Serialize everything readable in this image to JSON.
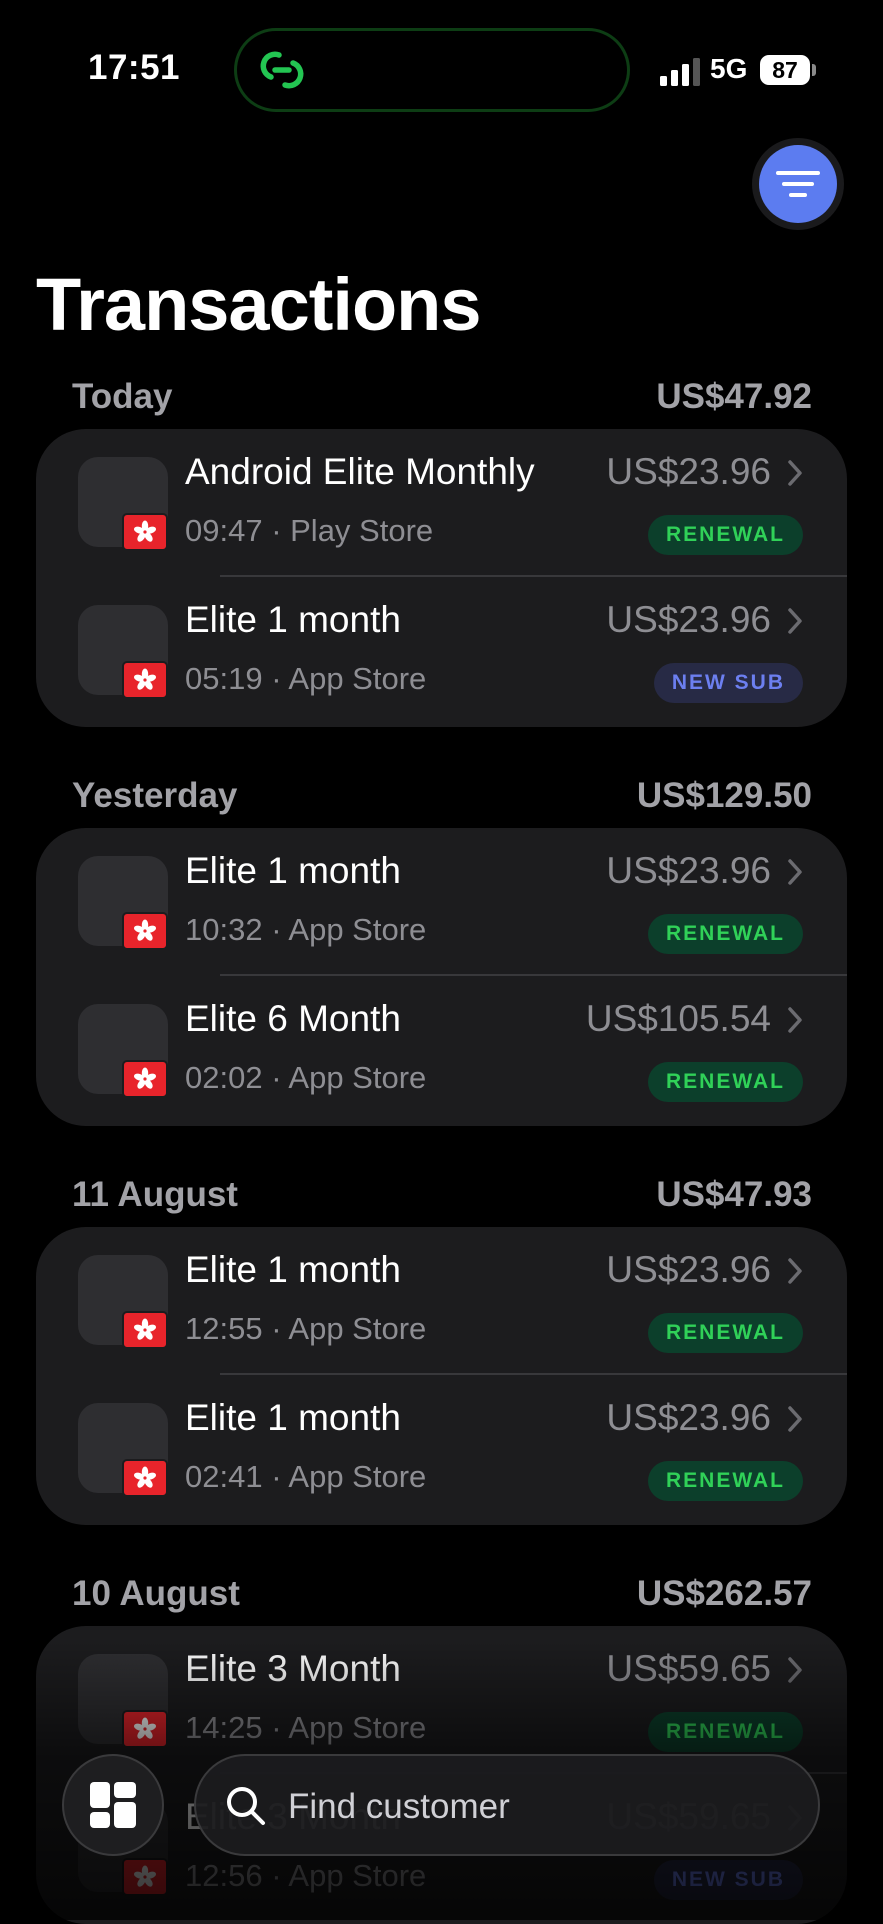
{
  "status_bar": {
    "time": "17:51",
    "network": "5G",
    "battery": "87"
  },
  "header": {
    "title": "Transactions"
  },
  "sections": [
    {
      "label": "Today",
      "total": "US$47.92",
      "items": [
        {
          "name": "Android Elite Monthly",
          "time": "09:47",
          "store": "Play Store",
          "detail": "09:47 · Play Store",
          "amount": "US$23.96",
          "badge": "RENEWAL",
          "badge_type": "renewal"
        },
        {
          "name": "Elite 1 month",
          "time": "05:19",
          "store": "App Store",
          "detail": "05:19 · App Store",
          "amount": "US$23.96",
          "badge": "NEW SUB",
          "badge_type": "newsub"
        }
      ]
    },
    {
      "label": "Yesterday",
      "total": "US$129.50",
      "items": [
        {
          "name": "Elite 1 month",
          "time": "10:32",
          "store": "App Store",
          "detail": "10:32 · App Store",
          "amount": "US$23.96",
          "badge": "RENEWAL",
          "badge_type": "renewal"
        },
        {
          "name": "Elite 6 Month",
          "time": "02:02",
          "store": "App Store",
          "detail": "02:02 · App Store",
          "amount": "US$105.54",
          "badge": "RENEWAL",
          "badge_type": "renewal"
        }
      ]
    },
    {
      "label": "11 August",
      "total": "US$47.93",
      "items": [
        {
          "name": "Elite 1 month",
          "time": "12:55",
          "store": "App Store",
          "detail": "12:55 · App Store",
          "amount": "US$23.96",
          "badge": "RENEWAL",
          "badge_type": "renewal"
        },
        {
          "name": "Elite 1 month",
          "time": "02:41",
          "store": "App Store",
          "detail": "02:41 · App Store",
          "amount": "US$23.96",
          "badge": "RENEWAL",
          "badge_type": "renewal"
        }
      ]
    },
    {
      "label": "10 August",
      "total": "US$262.57",
      "items": [
        {
          "name": "Elite 3 Month",
          "time": "14:25",
          "store": "App Store",
          "detail": "14:25 · App Store",
          "amount": "US$59.65",
          "badge": "RENEWAL",
          "badge_type": "renewal"
        },
        {
          "name": "Elite 3 Month",
          "time": "12:56",
          "store": "App Store",
          "detail": "12:56 · App Store",
          "amount": "US$59.65",
          "badge": "NEW SUB",
          "badge_type": "newsub"
        }
      ]
    }
  ],
  "search": {
    "placeholder": "Find customer"
  },
  "icons": {
    "app_logo": "link-rings-icon",
    "filter": "filter-lines-icon",
    "country_flag": "hong-kong-flag-icon",
    "chevron": "chevron-right-icon",
    "dashboard": "dashboard-grid-icon",
    "search": "search-icon"
  },
  "colors": {
    "accent": "#5c7cf0",
    "renewal_text": "#30d158",
    "renewal_bg": "#0c3f2b",
    "newsub_text": "#6c7ff0",
    "newsub_bg": "#272a45",
    "card_bg": "#1c1c1e",
    "island_glow": "#23c552"
  }
}
